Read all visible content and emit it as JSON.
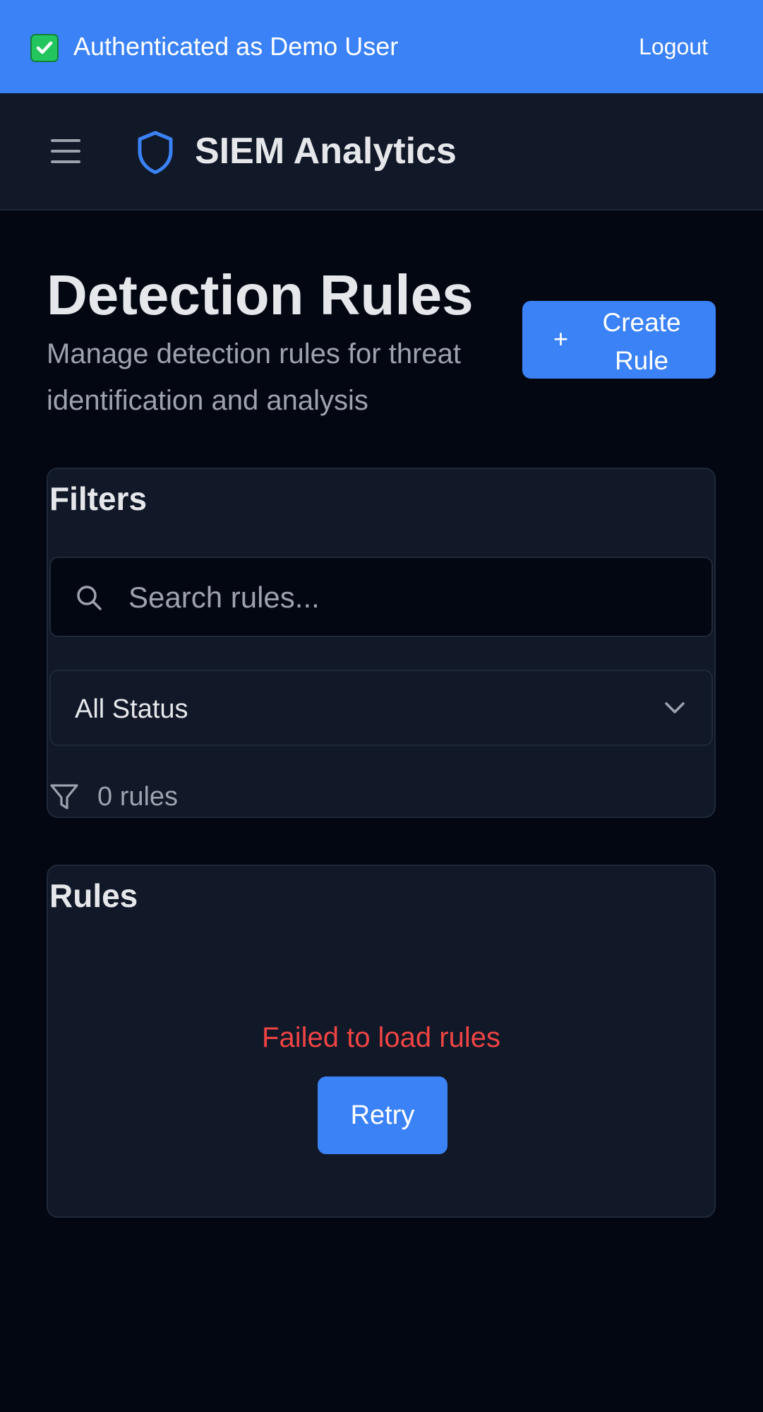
{
  "auth_bar": {
    "status_icon": "check-mark-icon",
    "text": "Authenticated as Demo User",
    "logout_label": "Logout",
    "background": "#3b82f6"
  },
  "header": {
    "menu_icon": "hamburger-menu-icon",
    "logo_icon": "shield-icon",
    "brand": "SIEM Analytics",
    "accent": "#3b82f6"
  },
  "page": {
    "title": "Detection Rules",
    "subtitle": "Manage detection rules for threat identification and analysis",
    "create_button": {
      "icon": "plus-icon",
      "label": "Create Rule"
    }
  },
  "filters": {
    "title": "Filters",
    "search": {
      "icon": "search-icon",
      "placeholder": "Search rules...",
      "value": ""
    },
    "status_select": {
      "selected": "All Status",
      "icon": "chevron-down-icon"
    },
    "count": {
      "icon": "filter-icon",
      "text": "0 rules"
    }
  },
  "rules": {
    "title": "Rules",
    "error_message": "Failed to load rules",
    "error_color": "#ef4444",
    "retry_label": "Retry"
  }
}
